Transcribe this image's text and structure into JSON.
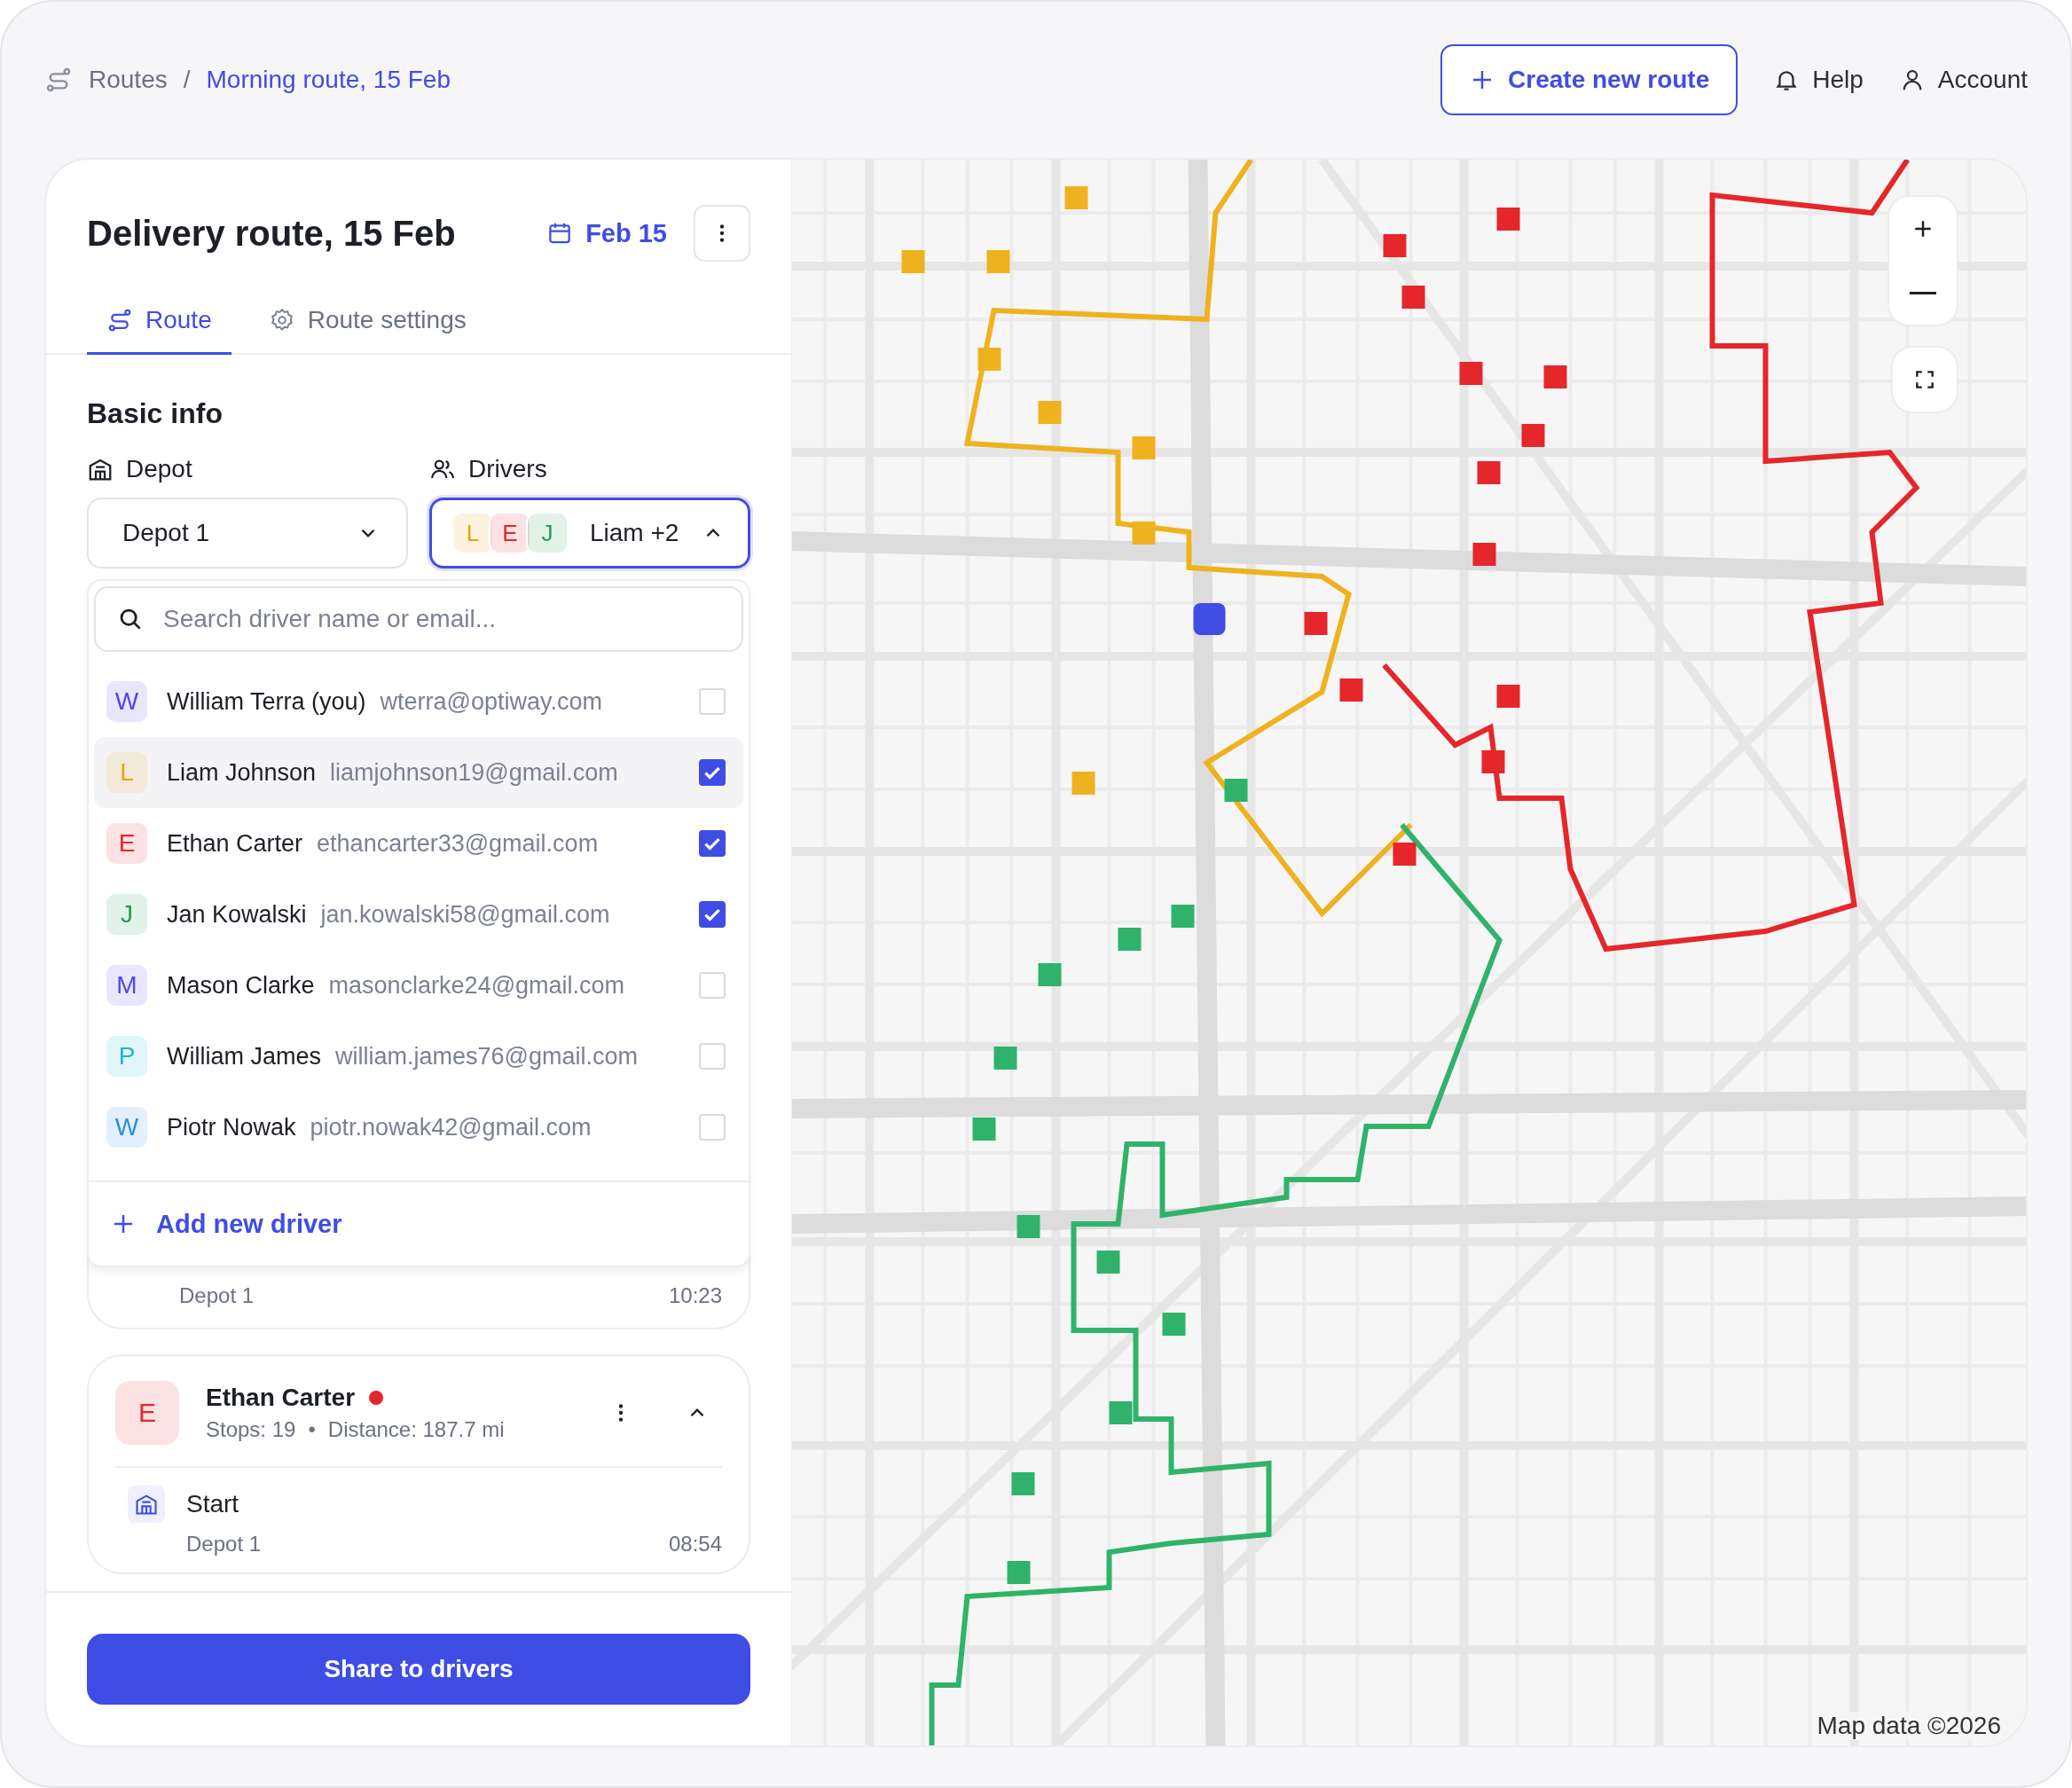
{
  "breadcrumb": {
    "items": [
      {
        "label": "Routes",
        "current": false
      },
      {
        "label": "Morning route, 15 Feb",
        "current": true
      }
    ],
    "separator": "/"
  },
  "header_actions": {
    "create": "Create new route",
    "help": "Help",
    "account": "Account"
  },
  "panel": {
    "title": "Delivery route, 15 Feb",
    "date": "Feb 15",
    "tabs": [
      {
        "label": "Route",
        "selected": true
      },
      {
        "label": "Route settings",
        "selected": false
      }
    ],
    "section": "Basic info",
    "depot": {
      "label": "Depot",
      "value": "Depot 1"
    },
    "drivers": {
      "label": "Drivers",
      "value": "Liam +2",
      "expanded": true,
      "avatars": [
        {
          "letter": "L",
          "color": "#e9a20c"
        },
        {
          "letter": "E",
          "color": "#e5262b"
        },
        {
          "letter": "J",
          "color": "#1f9d55"
        }
      ]
    }
  },
  "dropdown": {
    "placeholder": "Search driver name or email...",
    "add_label": "Add new driver",
    "options": [
      {
        "initial": "W",
        "color": "#4f46e5",
        "name": "William Terra (you)",
        "email": "wterra@optiway.com",
        "checked": false,
        "highlighted": false
      },
      {
        "initial": "L",
        "color": "#e9a20c",
        "name": "Liam Johnson",
        "email": "liamjohnson19@gmail.com",
        "checked": true,
        "highlighted": true
      },
      {
        "initial": "E",
        "color": "#e5262b",
        "name": "Ethan Carter",
        "email": "ethancarter33@gmail.com",
        "checked": true,
        "highlighted": false
      },
      {
        "initial": "J",
        "color": "#1f9d55",
        "name": "Jan Kowalski",
        "email": "jan.kowalski58@gmail.com",
        "checked": true,
        "highlighted": false
      },
      {
        "initial": "M",
        "color": "#4f46e5",
        "name": "Mason Clarke",
        "email": "masonclarke24@gmail.com",
        "checked": false,
        "highlighted": false
      },
      {
        "initial": "P",
        "color": "#14b8c7",
        "name": "William James",
        "email": "william.james76@gmail.com",
        "checked": false,
        "highlighted": false
      },
      {
        "initial": "W",
        "color": "#2b8fe0",
        "name": "Piotr Nowak",
        "email": "piotr.nowak42@gmail.com",
        "checked": false,
        "highlighted": false
      }
    ]
  },
  "driver_cards": [
    {
      "stops": [
        {
          "place": "Depot 1",
          "time": "10:23"
        }
      ]
    },
    {
      "initial": "E",
      "color": "#e5262b",
      "name": "Ethan Carter",
      "status": {
        "color": "#e5262b"
      },
      "stops_count": "Stops: 19",
      "bullet": "•",
      "distance": "Distance: 187.7 mi",
      "expanded": true,
      "stops": [
        {
          "title": "Start",
          "place": "Depot 1",
          "time": "08:54"
        }
      ]
    }
  ],
  "share_button": "Share to drivers",
  "map": {
    "kind": "picture",
    "attribution": "Map data ©2026"
  }
}
